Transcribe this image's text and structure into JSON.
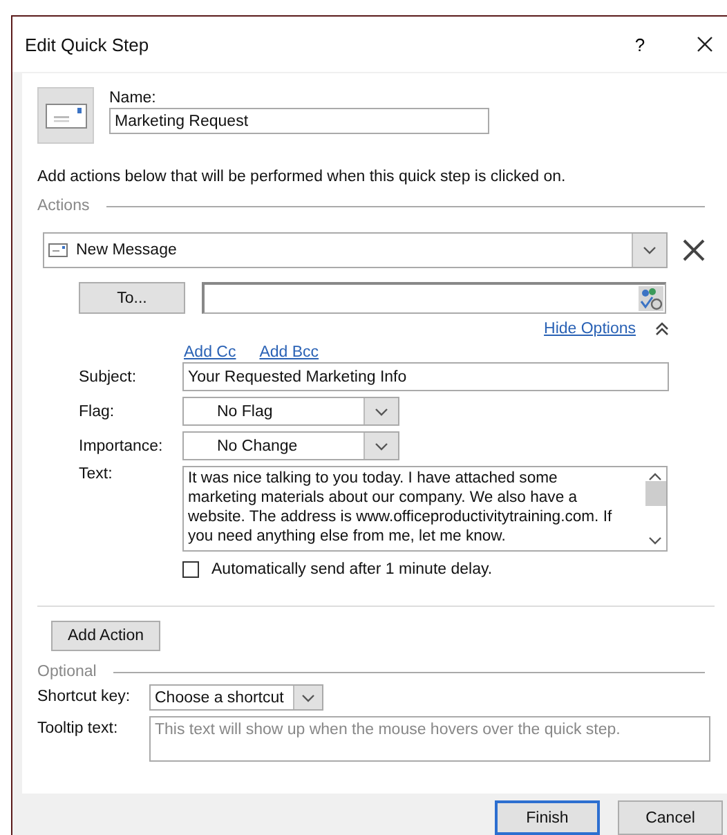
{
  "window": {
    "title": "Edit Quick Step",
    "help": "?"
  },
  "name": {
    "label": "Name:",
    "value": "Marketing Request"
  },
  "instruction": "Add actions below that will be performed when this quick step is clicked on.",
  "actions": {
    "legend": "Actions",
    "action": {
      "value": "New Message"
    },
    "to_button": "To...",
    "hide_options": "Hide Options",
    "expanded": true,
    "add_cc": "Add Cc",
    "add_bcc": "Add Bcc",
    "fields": [
      {
        "kind": "text",
        "label": "Subject:",
        "value": "Your Requested Marketing Info"
      },
      {
        "kind": "dropdown",
        "label": "Flag:",
        "value": "No Flag"
      },
      {
        "kind": "dropdown",
        "label": "Importance:",
        "value": "No Change"
      },
      {
        "kind": "textarea",
        "label": "Text:",
        "value": "It was nice talking to you today. I have attached some marketing materials about our company. We also have a website. The address is www.officeproductivitytraining.com. If you need anything else from me, let me know."
      }
    ],
    "auto_send": {
      "label": "Automatically send after 1 minute delay.",
      "checked": false
    }
  },
  "add_action": "Add Action",
  "optional": {
    "legend": "Optional",
    "shortcut": {
      "label": "Shortcut key:",
      "value": "Choose a shortcut"
    },
    "tooltip": {
      "label": "Tooltip text:",
      "placeholder": "This text will show up when the mouse hovers over the quick step."
    }
  },
  "buttons": [
    {
      "label": "Finish",
      "default": true
    },
    {
      "label": "Cancel",
      "default": false
    }
  ]
}
